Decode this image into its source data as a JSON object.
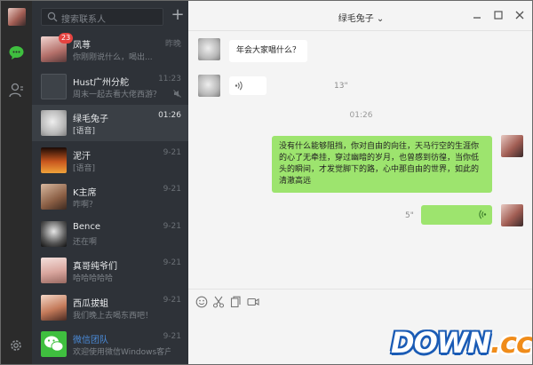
{
  "search": {
    "placeholder": "搜索联系人"
  },
  "header": {
    "title": "绿毛兔子 ⌄"
  },
  "chats": [
    {
      "name": "凤荨",
      "preview": "你刚刚说什么，喝出...",
      "time": "昨晚",
      "badge": "23",
      "active": false
    },
    {
      "name": "Hust广州分舵",
      "preview": "周末一起去看大佬西游？",
      "time": "11:23",
      "muted": true,
      "active": false
    },
    {
      "name": "绿毛兔子",
      "preview": "[语音]",
      "time": "01:26",
      "active": true
    },
    {
      "name": "泥汗",
      "preview": "[语音]",
      "time": "9-21",
      "active": false
    },
    {
      "name": "K主席",
      "preview": "咋啊？",
      "time": "9-21",
      "active": false
    },
    {
      "name": "Bence",
      "preview": "还在啊",
      "time": "9-21",
      "active": false
    },
    {
      "name": "真哥纯爷们",
      "preview": "哈哈哈哈哈",
      "time": "9-21",
      "active": false
    },
    {
      "name": "西瓜拔蛆",
      "preview": "我们晚上去喝东西吧！",
      "time": "9-21",
      "active": false
    },
    {
      "name": "微信团队",
      "preview": "欢迎使用微信Windows客户端...",
      "time": "9-21",
      "active": false
    }
  ],
  "messages": {
    "m1": "年会大家唱什么？",
    "voice1_duration": "13\"",
    "time_sep": "01:26",
    "m3": "没有什么能够阻挡，你对自由的向往，天马行空的生涯你的心了无牵挂，穿过幽暗的岁月，也曾感到彷徨，当你低头的瞬间，才发觉脚下的路，心中那自由的世界，如此的清澈高远",
    "voice2_duration": "5\""
  },
  "watermark": {
    "main": "DOWN",
    "suffix": ".cc"
  },
  "colors": {
    "nav_bg": "#2b2b2b",
    "list_bg": "#2e3238",
    "my_bubble": "#9de46e",
    "badge": "#e64340",
    "chat_bg": "#f4f4f4"
  }
}
